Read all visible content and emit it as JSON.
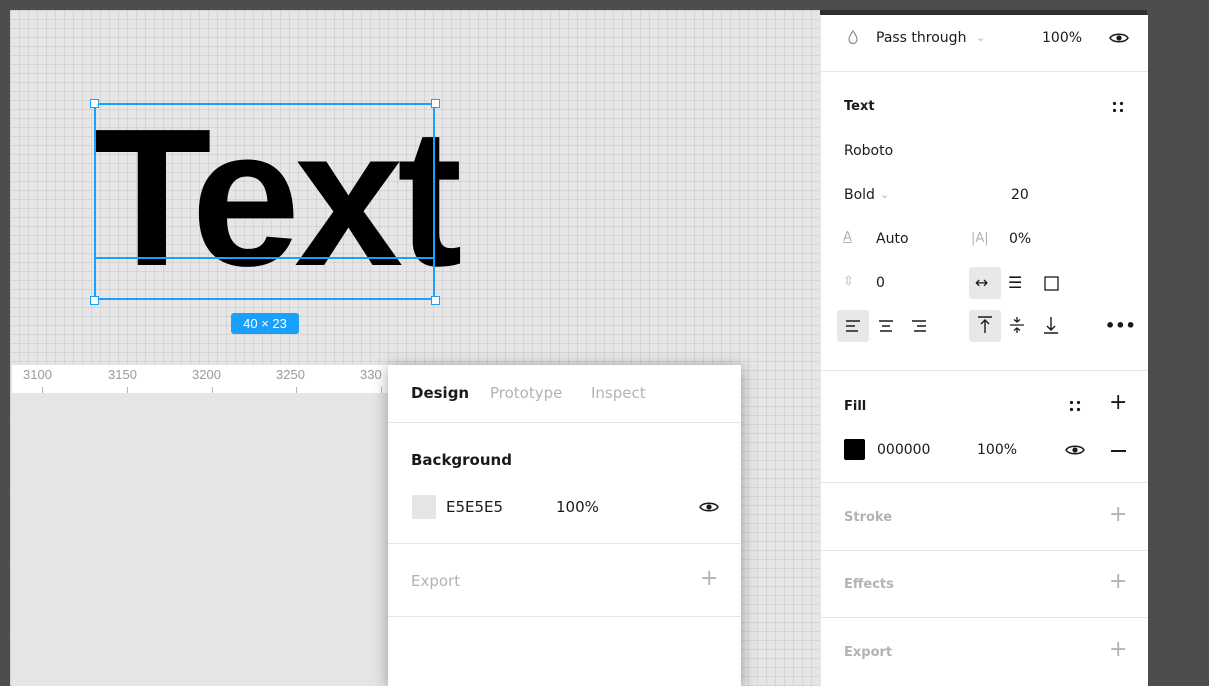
{
  "canvas": {
    "text_layer": "Text",
    "size_badge": "40 × 23",
    "ruler_ticks": [
      "3100",
      "3150",
      "3200",
      "3250",
      "330"
    ]
  },
  "right_panel": {
    "layer": {
      "blend_mode": "Pass through",
      "opacity": "100%"
    },
    "text": {
      "title": "Text",
      "font_family": "Roboto",
      "font_weight": "Bold",
      "font_size": "20",
      "line_height": "Auto",
      "letter_spacing": "0%",
      "paragraph_spacing": "0"
    },
    "fill": {
      "title": "Fill",
      "color_hex": "000000",
      "opacity": "100%",
      "swatch": "#000000"
    },
    "stroke": {
      "title": "Stroke"
    },
    "effects": {
      "title": "Effects"
    },
    "export": {
      "title": "Export"
    }
  },
  "overlay_panel": {
    "tabs": [
      "Design",
      "Prototype",
      "Inspect"
    ],
    "background": {
      "title": "Background",
      "color_hex": "E5E5E5",
      "opacity": "100%",
      "swatch": "#e5e5e5"
    },
    "export": {
      "title": "Export"
    }
  },
  "colors": {
    "accent": "#18a0fb",
    "canvas": "#e6e6e6",
    "chrome": "#4d4d50"
  }
}
